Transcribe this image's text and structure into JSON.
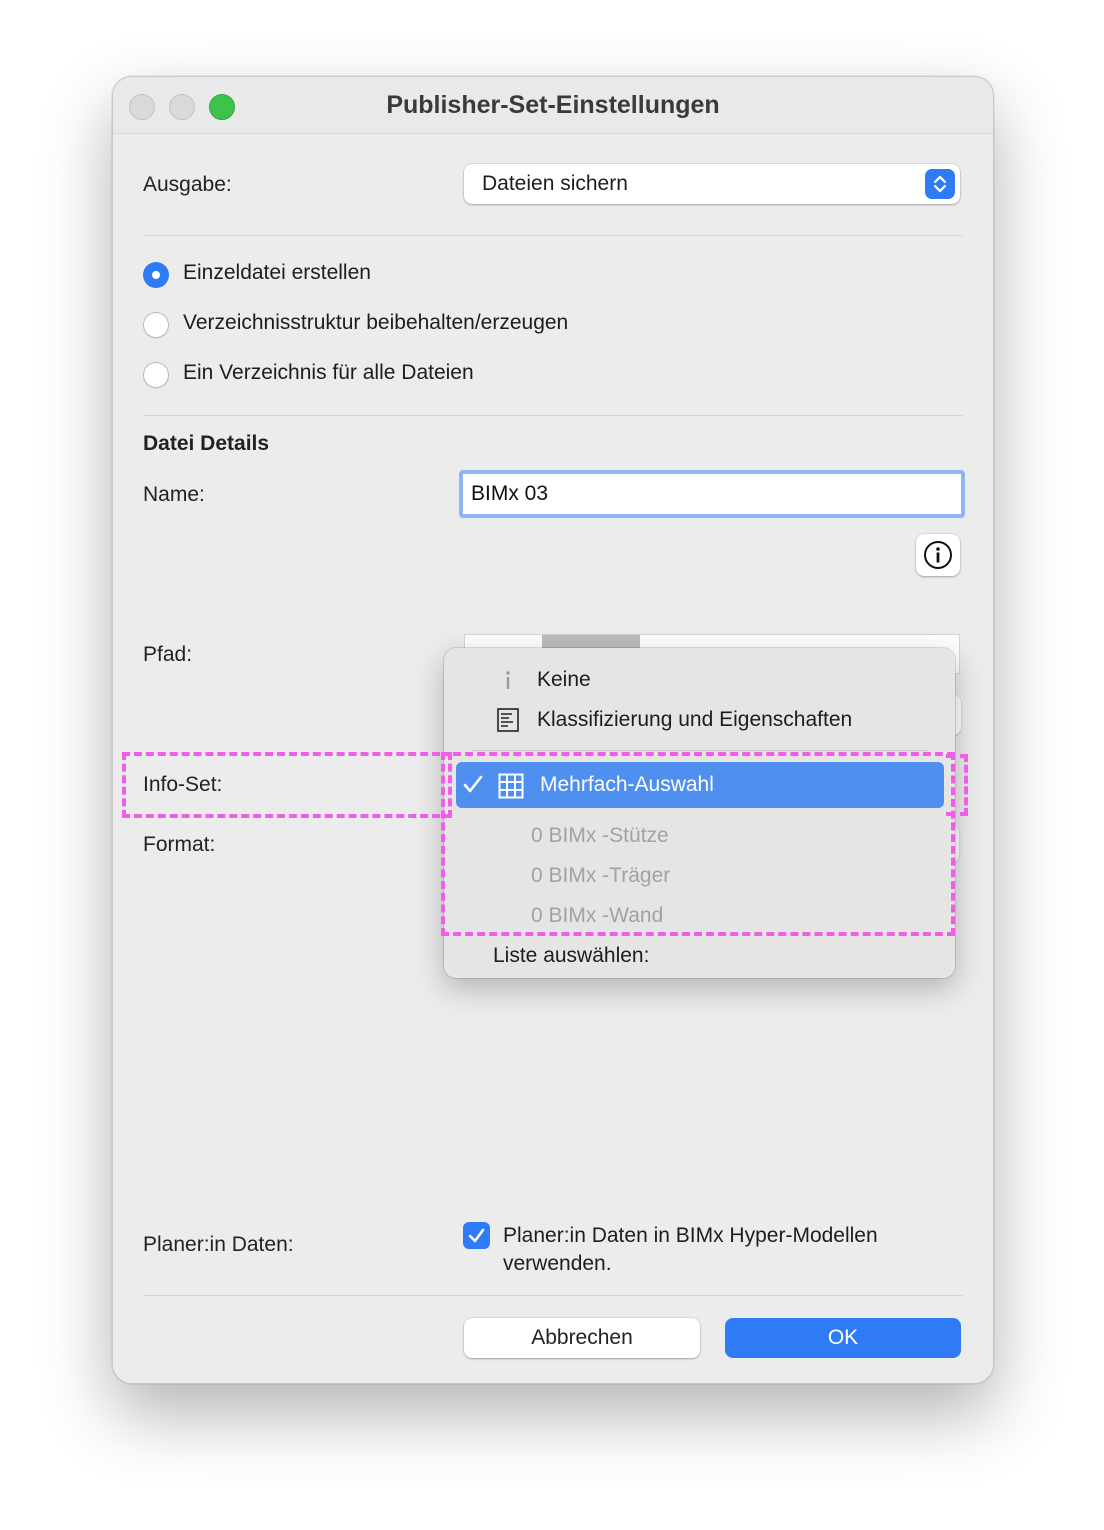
{
  "window": {
    "title": "Publisher-Set-Einstellungen"
  },
  "output": {
    "label": "Ausgabe:",
    "value": "Dateien sichern"
  },
  "radios": [
    {
      "label": "Einzeldatei erstellen",
      "selected": true
    },
    {
      "label": "Verzeichnisstruktur beibehalten/erzeugen",
      "selected": false
    },
    {
      "label": "Ein Verzeichnis für alle Dateien",
      "selected": false
    }
  ],
  "details": {
    "heading": "Datei Details",
    "name_label": "Name:",
    "name_value": "BIMx 03",
    "path_label": "Pfad:",
    "infoset_label": "Info-Set:",
    "format_label": "Format:"
  },
  "menu": {
    "items": [
      {
        "label": "Keine",
        "icon": "info-glyph-icon"
      },
      {
        "label": "Klassifizierung und Eigenschaften",
        "icon": "document-lines-icon"
      }
    ],
    "selected": {
      "label": "Mehrfach-Auswahl",
      "icon": "grid-table-icon",
      "checked": true
    },
    "disabled_items": [
      "0 BIMx -Stütze",
      "0 BIMx -Träger",
      "0 BIMx -Wand"
    ],
    "footer": "Liste auswählen:"
  },
  "planer": {
    "label": "Planer:in Daten:",
    "checkbox_label": "Planer:in Daten in BIMx Hyper-Modellen verwenden.",
    "checked": true
  },
  "buttons": {
    "cancel": "Abbrechen",
    "ok": "OK"
  },
  "colors": {
    "accent": "#2f7bf5",
    "highlight": "#ee5ee8",
    "menu_selection": "#4f8ff0"
  }
}
